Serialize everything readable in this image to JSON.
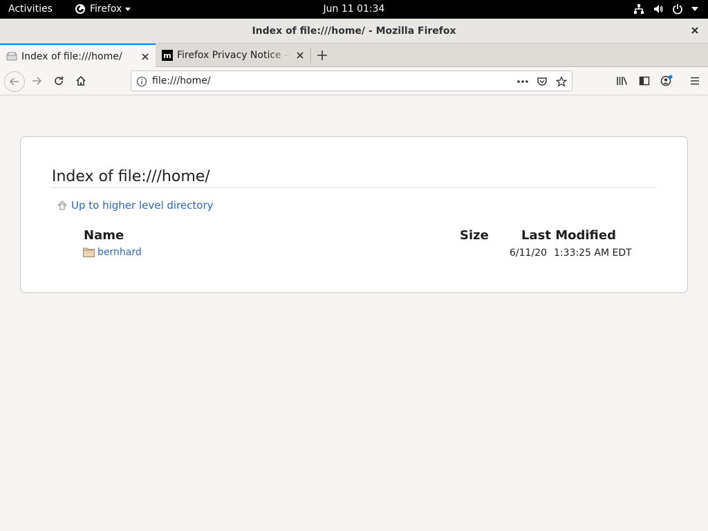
{
  "topbar": {
    "activities": "Activities",
    "app_name": "Firefox",
    "clock": "Jun 11  01:34"
  },
  "window": {
    "title": "Index of file:///home/ - Mozilla Firefox"
  },
  "tabs": [
    {
      "label": "Index of file:///home/",
      "active": true
    },
    {
      "label": "Firefox Privacy Notice — Mozilla",
      "active": false
    }
  ],
  "navbar": {
    "url": "file:///home/"
  },
  "page": {
    "heading": "Index of file:///home/",
    "up_link": "Up to higher level directory",
    "columns": {
      "name": "Name",
      "size": "Size",
      "modified": "Last Modified"
    },
    "entries": [
      {
        "name": "bernhard",
        "size": "",
        "date": "6/11/20",
        "time": "1:33:25 AM EDT"
      }
    ]
  },
  "colors": {
    "accent": "#0a84ff",
    "link": "#2f67b7"
  }
}
